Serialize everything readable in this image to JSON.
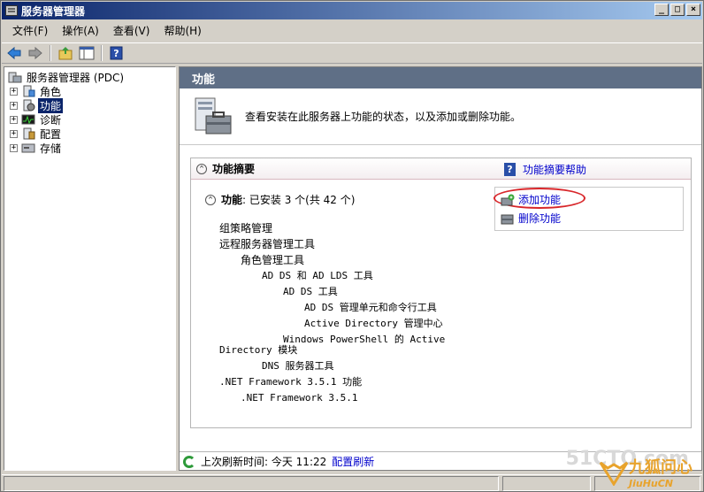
{
  "window": {
    "title": "服务器管理器"
  },
  "menu": [
    "文件(F)",
    "操作(A)",
    "查看(V)",
    "帮助(H)"
  ],
  "tree": {
    "root": "服务器管理器 (PDC)",
    "items": [
      {
        "label": "角色",
        "expander": "+"
      },
      {
        "label": "功能",
        "expander": "+",
        "selected": true
      },
      {
        "label": "诊断",
        "expander": "+"
      },
      {
        "label": "配置",
        "expander": "+"
      },
      {
        "label": "存储",
        "expander": "+"
      }
    ]
  },
  "main": {
    "header": "功能",
    "intro": "查看安装在此服务器上功能的状态，以及添加或删除功能。",
    "summary": {
      "title": "功能摘要",
      "help_link": "功能摘要帮助",
      "sub_title_bold": "功能",
      "sub_title_rest": ": 已安装 3 个(共 42 个)",
      "features": [
        "组策略管理",
        "远程服务器管理工具",
        "角色管理工具",
        "AD DS 和 AD LDS 工具",
        "AD DS 工具",
        "AD DS 管理单元和命令行工具",
        "Active Directory 管理中心",
        "Windows PowerShell 的 Active",
        "Directory 模块",
        "DNS 服务器工具",
        ".NET Framework 3.5.1 功能",
        ".NET Framework 3.5.1"
      ],
      "actions": [
        "添加功能",
        "删除功能"
      ]
    },
    "refresh": {
      "label": "上次刷新时间: 今天 11:22",
      "link": "配置刷新"
    }
  },
  "overlay": {
    "watermark": "51CTO.com",
    "brand_main": "九狐问心",
    "brand_sub": "JiuHuCN"
  },
  "colors": {
    "title_start": "#0a246a",
    "header_bg": "#5f6f86",
    "link": "#0000cc",
    "highlight": "#d8262a"
  }
}
